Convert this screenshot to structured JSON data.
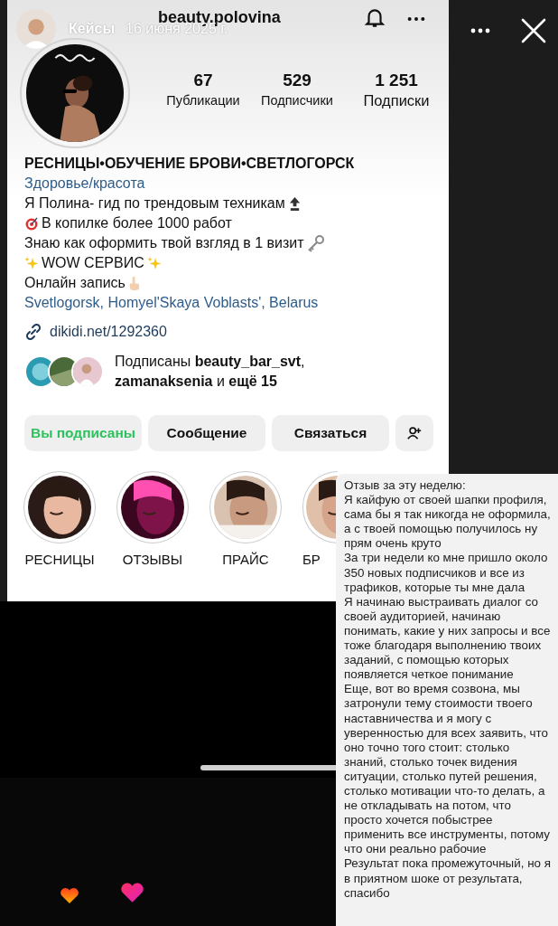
{
  "story": {
    "author": "Кейсы",
    "date": "16 июня 2025 г."
  },
  "profile": {
    "username": "beauty.polovina",
    "stats": [
      {
        "value": "67",
        "label": "Публикации"
      },
      {
        "value": "529",
        "label": "Подписчики"
      },
      {
        "value": "1 251",
        "label": "Подписки"
      }
    ],
    "name": "РЕСНИЦЫ•ОБУЧЕНИЕ БРОВИ•СВЕТЛОГОРСК",
    "category": "Здоровье/красота",
    "bio": [
      {
        "text": "Я Полина- гид по трендовым техникам",
        "kind": "top"
      },
      {
        "text": "В копилке более 1000 работ",
        "kind": "target"
      },
      {
        "text": "Знаю как оформить твой взгляд в 1 визит",
        "kind": "key"
      },
      {
        "text": "WOW СЕРВИС",
        "kind": "sparkles"
      },
      {
        "text": "Онлайн запись",
        "kind": "pointing"
      }
    ],
    "location": "Svetlogorsk, Homyel'Skaya Voblasts', Belarus",
    "link": "dikidi.net/1292360",
    "followed_by": "Подписаны **beauty_bar_svt**, **zamanaksenia** и **ещё 15**",
    "buttons": [
      {
        "label": "Вы подписаны",
        "kind": "following"
      },
      {
        "label": "Сообщение",
        "kind": "plain"
      },
      {
        "label": "Связаться",
        "kind": "plain"
      },
      {
        "kind": "add-person"
      }
    ],
    "highlights": [
      {
        "label": "РЕСНИЦЫ"
      },
      {
        "label": "ОТЗЫВЫ"
      },
      {
        "label": "ПРАЙС"
      },
      {
        "label": "БР"
      }
    ]
  },
  "review": {
    "paragraphs": [
      "Отзыв за эту неделю:",
      "Я кайфую от своей шапки профиля, сама бы я так никогда не оформила, а с твоей помощью получилось ну прям очень круто",
      "За три недели ко мне пришло около 350 новых подписчиков и все из трафиков, которые ты мне дала",
      "Я начинаю выстраивать диалог со своей аудиторией, начинаю понимать, какие у них запросы и все тоже благодаря выполнению твоих заданий, с помощью которых появляется четкое понимание",
      "Еще, вот во время созвона, мы затронули тему стоимости твоего наставничества и я могу с уверенностью для всех заявить, что оно точно того стоит: столько знаний, столько точек видения ситуации, столько путей решения, столько мотивации что-то делать, а не откладывать на потом, что просто хочется побыстрее применить все инструменты, потому что они реально рабочие",
      "Результат пока промежуточный, но я в приятном шоке от результата, спасибо"
    ]
  }
}
